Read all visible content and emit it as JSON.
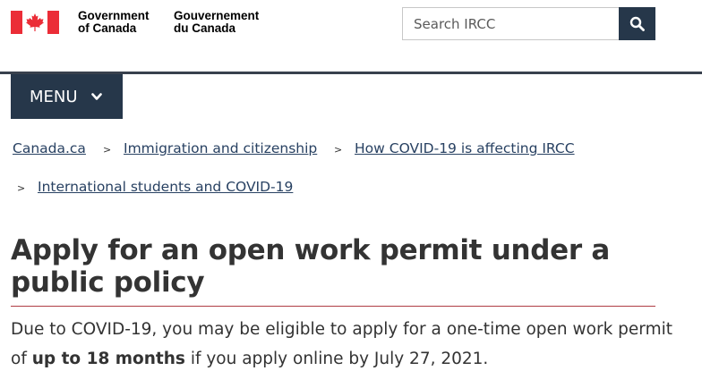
{
  "header": {
    "signature_en": [
      "Government",
      "of Canada"
    ],
    "signature_fr": [
      "Gouvernement",
      "du Canada"
    ],
    "flag_icon": "canada-flag-icon",
    "search": {
      "placeholder": "Search IRCC",
      "button_icon": "search-icon"
    }
  },
  "menu": {
    "label": "MENU",
    "icon": "chevron-down-icon"
  },
  "breadcrumbs": [
    {
      "label": "Canada.ca"
    },
    {
      "label": "Immigration and citizenship"
    },
    {
      "label": "How COVID-19 is affecting IRCC"
    },
    {
      "label": "International students and COVID-19"
    }
  ],
  "page": {
    "title": "Apply for an open work permit under a public policy",
    "intro_before": "Due to COVID-19, you may be eligible to apply for a one-time open work permit of ",
    "intro_bold": "up to 18 months",
    "intro_after": " if you apply online by July 27, 2021."
  },
  "colors": {
    "brand_dark": "#26374a",
    "link": "#284162",
    "flag_red": "#eb2d37",
    "title_rule": "#af3c43"
  }
}
